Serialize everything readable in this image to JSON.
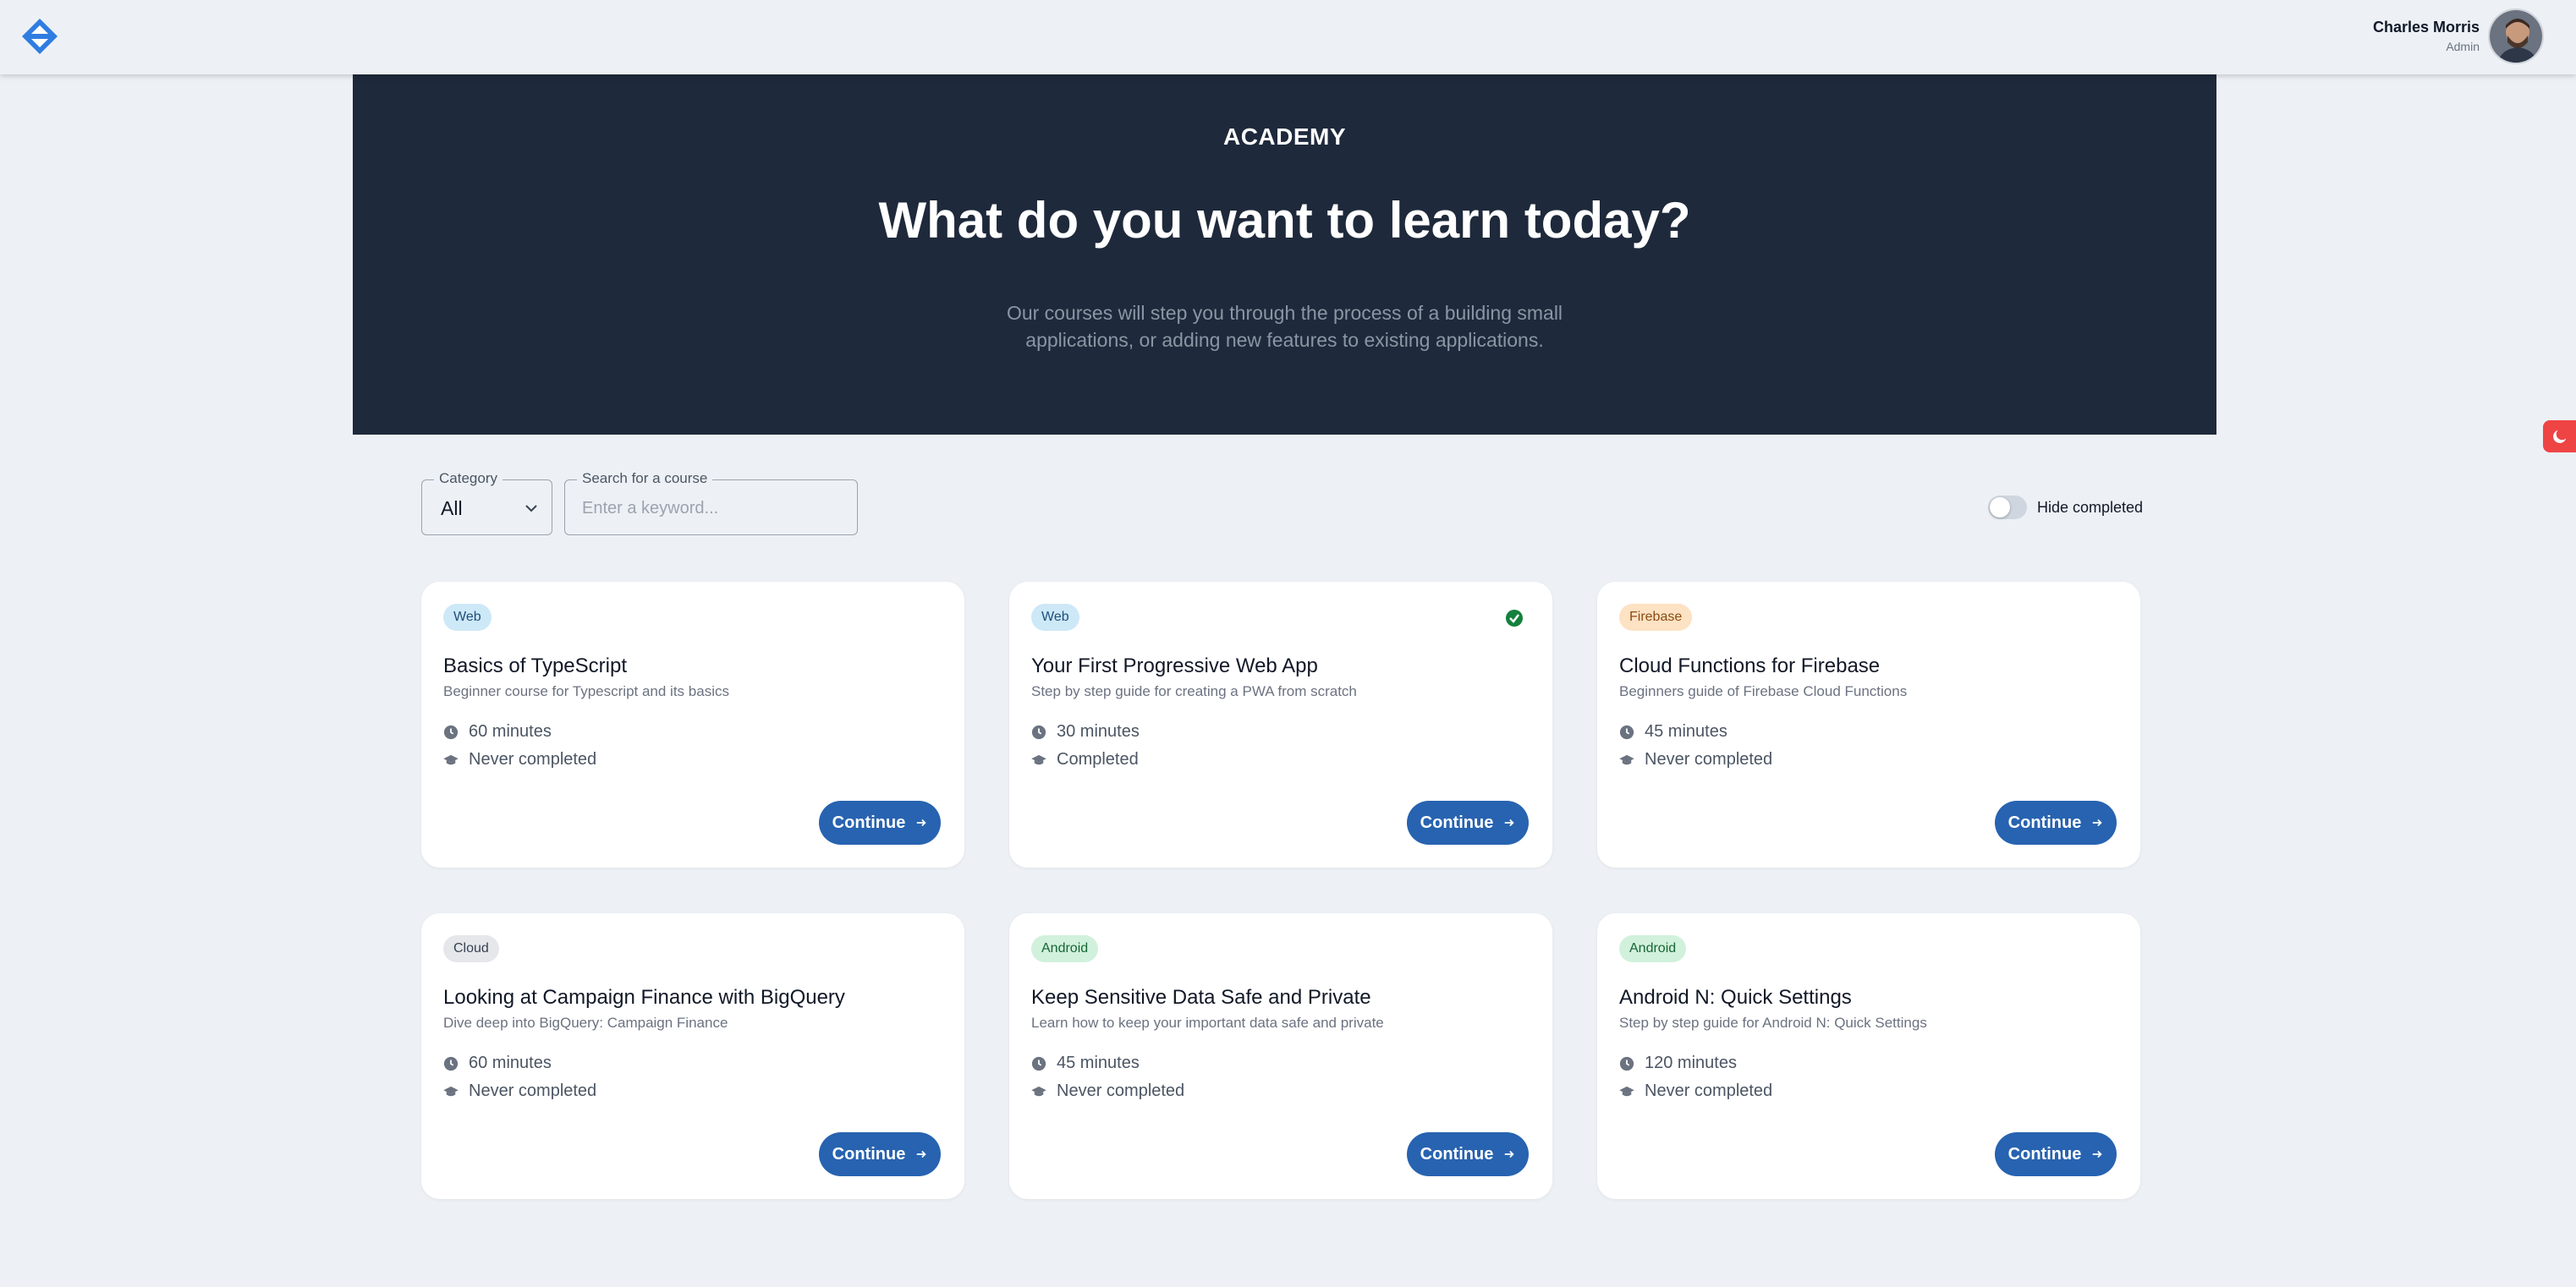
{
  "header": {
    "user_name": "Charles Morris",
    "user_role": "Admin"
  },
  "hero": {
    "kicker": "ACADEMY",
    "title": "What do you want to learn today?",
    "subtitle": "Our courses will step you through the process of a building small applications, or adding new features to existing applications."
  },
  "filters": {
    "category_label": "Category",
    "category_value": "All",
    "search_label": "Search for a course",
    "search_placeholder": "Enter a keyword...",
    "hide_completed_label": "Hide completed",
    "hide_completed_on": false
  },
  "courses": [
    {
      "category": "Web",
      "title": "Basics of TypeScript",
      "description": "Beginner course for Typescript and its basics",
      "duration": "60 minutes",
      "status": "Never completed",
      "completed": false,
      "action": "Continue"
    },
    {
      "category": "Web",
      "title": "Your First Progressive Web App",
      "description": "Step by step guide for creating a PWA from scratch",
      "duration": "30 minutes",
      "status": "Completed",
      "completed": true,
      "action": "Continue"
    },
    {
      "category": "Firebase",
      "title": "Cloud Functions for Firebase",
      "description": "Beginners guide of Firebase Cloud Functions",
      "duration": "45 minutes",
      "status": "Never completed",
      "completed": false,
      "action": "Continue"
    },
    {
      "category": "Cloud",
      "title": "Looking at Campaign Finance with BigQuery",
      "description": "Dive deep into BigQuery: Campaign Finance",
      "duration": "60 minutes",
      "status": "Never completed",
      "completed": false,
      "action": "Continue"
    },
    {
      "category": "Android",
      "title": "Keep Sensitive Data Safe and Private",
      "description": "Learn how to keep your important data safe and private",
      "duration": "45 minutes",
      "status": "Never completed",
      "completed": false,
      "action": "Continue"
    },
    {
      "category": "Android",
      "title": "Android N: Quick Settings",
      "description": "Step by step guide for Android N: Quick Settings",
      "duration": "120 minutes",
      "status": "Never completed",
      "completed": false,
      "action": "Continue"
    }
  ],
  "colors": {
    "hero_bg": "#1e293b",
    "primary_button": "#2763b0",
    "theme_button": "#ef4444",
    "completed_check": "#15803d"
  },
  "icons": {
    "logo": "brand-logo-icon",
    "theme": "moon-icon",
    "duration": "clock-icon",
    "status": "graduation-cap-icon",
    "completed": "check-circle-icon",
    "continue": "arrow-right-icon"
  }
}
